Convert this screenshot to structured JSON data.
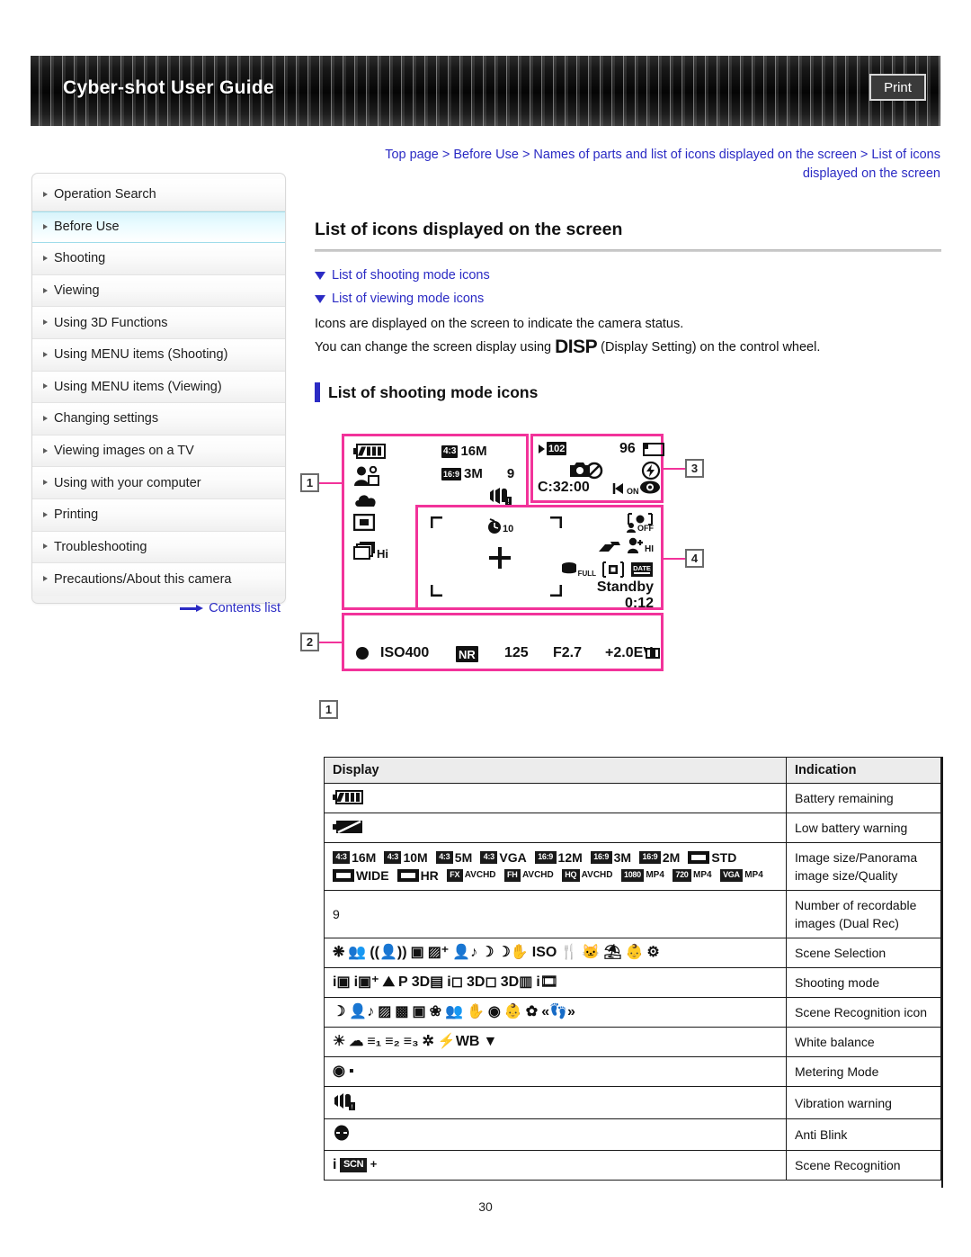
{
  "header": {
    "title": "Cyber-shot User Guide",
    "print_label": "Print"
  },
  "breadcrumb": {
    "text": "Top page > Before Use > Names of parts and list of icons displayed on the screen > List of icons displayed on the screen"
  },
  "sidebar": {
    "items": [
      {
        "label": "Operation Search",
        "active": false
      },
      {
        "label": "Before Use",
        "active": true
      },
      {
        "label": "Shooting",
        "active": false
      },
      {
        "label": "Viewing",
        "active": false
      },
      {
        "label": "Using 3D Functions",
        "active": false
      },
      {
        "label": "Using MENU items (Shooting)",
        "active": false
      },
      {
        "label": "Using MENU items (Viewing)",
        "active": false
      },
      {
        "label": "Changing settings",
        "active": false
      },
      {
        "label": "Viewing images on a TV",
        "active": false
      },
      {
        "label": "Using with your computer",
        "active": false
      },
      {
        "label": "Printing",
        "active": false
      },
      {
        "label": "Troubleshooting",
        "active": false
      },
      {
        "label": "Precautions/About this camera",
        "active": false
      }
    ],
    "contents_link": "Contents list"
  },
  "main": {
    "page_title": "List of icons displayed on the screen",
    "jump_links": [
      "List of shooting mode icons",
      "List of viewing mode icons"
    ],
    "intro_line1": "Icons are displayed on the screen to indicate the camera status.",
    "intro_line2_a": "You can change the screen display using",
    "intro_disp": "DISP",
    "intro_line2_b": "(Display Setting) on the control wheel.",
    "section_title": "List of shooting mode icons"
  },
  "diagram": {
    "labels": {
      "one": "1",
      "two": "2",
      "three": "3",
      "four": "4"
    },
    "marker_below": "1",
    "zone1": {
      "ratio_43": "4:3",
      "size_16m": "16M",
      "ratio_169": "16:9",
      "size_3m": "3M",
      "recordable": "9",
      "burst": "Hi"
    },
    "zone3": {
      "folder": "102",
      "count": "96",
      "rec_time": "C:32:00",
      "flash_on": "ON"
    },
    "zone4": {
      "selftimer": "10",
      "face_off": "OFF",
      "smile_hi": "HI",
      "media_full": "FULL",
      "date": "DATE",
      "standby": "Standby",
      "elapsed": "0:12"
    },
    "zone2": {
      "iso": "ISO400",
      "nr": "NR",
      "shutter": "125",
      "aperture": "F2.7",
      "ev": "+2.0EV"
    }
  },
  "table": {
    "headers": {
      "display": "Display",
      "indication": "Indication"
    },
    "rows": [
      {
        "kind": "battery-full",
        "indication": "Battery remaining"
      },
      {
        "kind": "battery-low",
        "indication": "Low battery warning"
      },
      {
        "kind": "image-size",
        "indication": "Image size/Panorama image size/Quality",
        "line1": [
          {
            "chip": "4:3",
            "label": "16M"
          },
          {
            "chip": "4:3",
            "label": "10M"
          },
          {
            "chip": "4:3",
            "label": "5M"
          },
          {
            "chip": "4:3",
            "label": "VGA"
          },
          {
            "chip": "16:9",
            "label": "12M"
          },
          {
            "chip": "16:9",
            "label": "3M"
          },
          {
            "chip": "16:9",
            "label": "2M"
          },
          {
            "pano": true,
            "label": "STD"
          }
        ],
        "line2": [
          {
            "pano": true,
            "label": "WIDE"
          },
          {
            "pano": true,
            "label": "HR"
          },
          {
            "chip": "FX",
            "label": "AVCHD",
            "small": true
          },
          {
            "chip": "FH",
            "label": "AVCHD",
            "small": true
          },
          {
            "chip": "HQ",
            "label": "AVCHD",
            "small": true
          },
          {
            "chip": "1080",
            "label": "MP4",
            "small": true
          },
          {
            "chip": "720",
            "label": "MP4",
            "small": true
          },
          {
            "chip": "VGA",
            "label": "MP4",
            "small": true
          }
        ]
      },
      {
        "kind": "text",
        "text": "9",
        "indication": "Number of recordable images (Dual Rec)"
      },
      {
        "kind": "scene-selection",
        "indication": "Scene Selection",
        "glyphs": [
          "❋",
          "👥",
          "((👤))",
          "▣",
          "▨⁺",
          "👤♪",
          "☽",
          "☽✋",
          "ISO",
          "🍴",
          "🐱",
          "⛱",
          "👶",
          "⚙"
        ]
      },
      {
        "kind": "shooting-mode",
        "indication": "Shooting mode",
        "glyphs": [
          "i▣",
          "i▣⁺",
          "⛰",
          "P",
          "3D▤",
          "i◻",
          "3D◻",
          "3D▥",
          "i🎞"
        ]
      },
      {
        "kind": "scene-recognition",
        "indication": "Scene Recognition icon",
        "glyphs": [
          "☽",
          "👤♪",
          "▨",
          "▩",
          "▣",
          "❀",
          "👥",
          "✋",
          "◉",
          "👶",
          "✿",
          "«👣»"
        ]
      },
      {
        "kind": "white-balance",
        "indication": "White balance",
        "glyphs": [
          "☀",
          "☁",
          "≡₁",
          "≡₂",
          "≡₃",
          "✲",
          "⚡WB",
          "▼"
        ]
      },
      {
        "kind": "metering",
        "indication": "Metering Mode",
        "glyphs": [
          "◉",
          "▪"
        ]
      },
      {
        "kind": "vibration",
        "indication": "Vibration warning"
      },
      {
        "kind": "anti-blink",
        "indication": "Anti Blink"
      },
      {
        "kind": "scene-recog-i",
        "indication": "Scene Recognition",
        "label": "SCN"
      }
    ]
  },
  "page_number": "30"
}
